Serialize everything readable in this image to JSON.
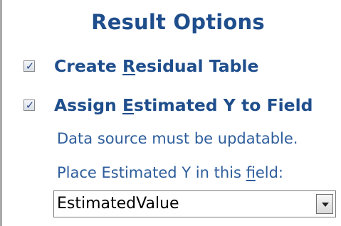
{
  "panel": {
    "title": "Result Options"
  },
  "options": {
    "residual_table": {
      "checked": true,
      "label_before": "Create ",
      "label_accel": "R",
      "label_after": "esidual Table"
    },
    "assign_estimated": {
      "checked": true,
      "label_before": "Assign ",
      "label_accel": "E",
      "label_after": "stimated Y to Field"
    }
  },
  "notes": {
    "updatable": "Data source must be updatable.",
    "place_before": "Place Estimated Y in this ",
    "place_accel": "f",
    "place_after": "ield:"
  },
  "field_select": {
    "value": "EstimatedValue"
  },
  "colors": {
    "heading": "#1f4e8c",
    "note_text": "#2d5d9c",
    "check_mark": "#2c4a86"
  },
  "icons": {
    "checkbox_mark": "checkmark-icon",
    "dropdown": "chevron-down-icon"
  }
}
